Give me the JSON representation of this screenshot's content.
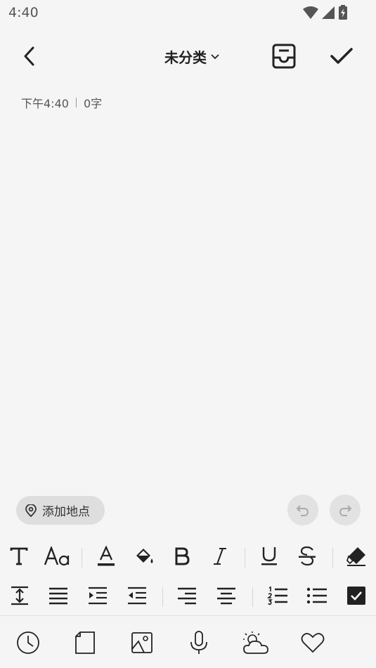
{
  "status": {
    "time": "4:40"
  },
  "header": {
    "category": "未分类"
  },
  "meta": {
    "time": "下午4:40",
    "word_count": "0字"
  },
  "location": {
    "label": "添加地点"
  },
  "icons": {
    "back": "chevron-left-icon",
    "dropdown": "chevron-down-icon",
    "archive": "inbox-icon",
    "done": "check-icon",
    "pin": "map-pin-icon",
    "undo": "undo-icon",
    "redo": "redo-icon"
  },
  "format_row_1": [
    "text-style-icon",
    "font-size-icon",
    "text-color-icon",
    "highlight-bucket-icon",
    "bold-icon",
    "italic-icon",
    "underline-icon",
    "strikethrough-icon",
    "eraser-icon"
  ],
  "format_row_2": [
    "line-height-icon",
    "align-left-icon",
    "indent-icon",
    "outdent-icon",
    "align-right-icon",
    "align-center-icon",
    "numbered-list-icon",
    "bullet-list-icon",
    "checkbox-icon"
  ],
  "bottom_tools": [
    "clock-icon",
    "document-icon",
    "image-icon",
    "microphone-icon",
    "weather-icon",
    "heart-icon"
  ],
  "colors": {
    "background": "#f5f5f5",
    "chip": "#dedede",
    "icon": "#222222",
    "muted": "#555555"
  }
}
